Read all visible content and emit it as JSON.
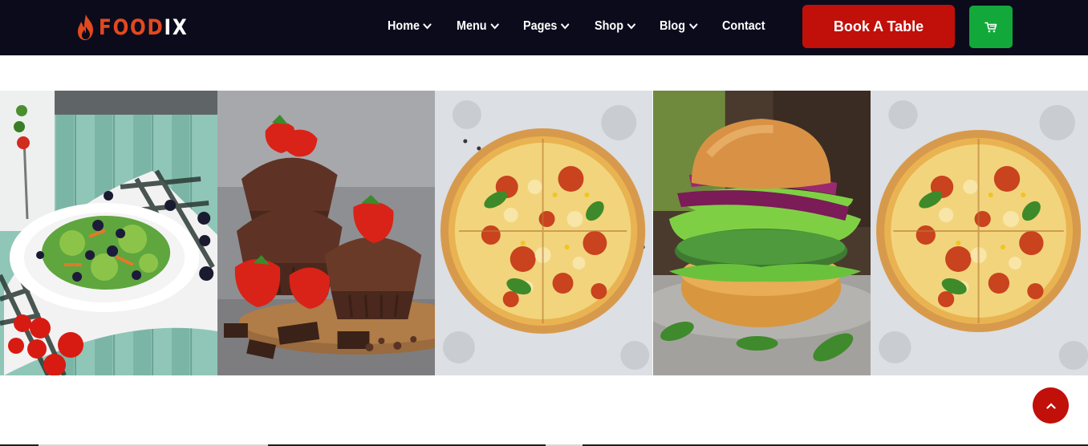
{
  "brand": {
    "name_head": "FOOD",
    "name_tail": "IX",
    "logo_icon": "flame-icon",
    "accent": "#e3491f"
  },
  "nav": {
    "items": [
      {
        "label": "Home",
        "has_dropdown": true
      },
      {
        "label": "Menu",
        "has_dropdown": true
      },
      {
        "label": "Pages",
        "has_dropdown": true
      },
      {
        "label": "Shop",
        "has_dropdown": true
      },
      {
        "label": "Blog",
        "has_dropdown": true
      },
      {
        "label": "Contact",
        "has_dropdown": false
      }
    ],
    "dropdown_icon": "chevron-down-icon"
  },
  "header_actions": {
    "book_label": "Book A Table",
    "cart_icon": "cart-icon",
    "book_color": "#c10f0a",
    "cart_color": "#13a83a"
  },
  "gallery": {
    "images": [
      {
        "subject": "salad",
        "icon": "salad-image"
      },
      {
        "subject": "muffins",
        "icon": "muffin-image"
      },
      {
        "subject": "pizza",
        "icon": "pizza-image"
      },
      {
        "subject": "burger",
        "icon": "burger-image"
      },
      {
        "subject": "pizza",
        "icon": "pizza-image"
      }
    ]
  },
  "scroll_top": {
    "icon": "chevron-up-icon",
    "color": "#c10f0a"
  },
  "colors": {
    "header_bg": "#0c0b1c"
  }
}
